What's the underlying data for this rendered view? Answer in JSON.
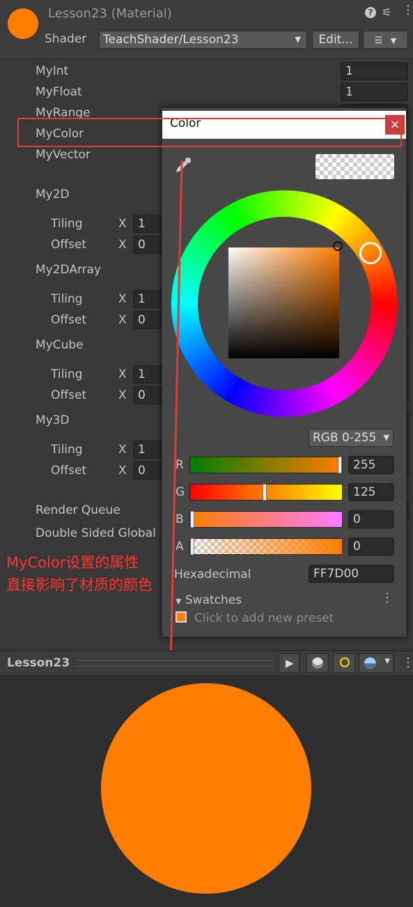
{
  "header": {
    "title": "Lesson23 (Material)",
    "shader_label": "Shader",
    "shader_value": "TeachShader/Lesson23",
    "edit_button": "Edit...",
    "material_color": "#ff7d00"
  },
  "properties": {
    "myint": {
      "label": "MyInt",
      "value": "1"
    },
    "myfloat": {
      "label": "MyFloat",
      "value": "1"
    },
    "myrange": {
      "label": "MyRange"
    },
    "mycolor": {
      "label": "MyColor"
    },
    "myvector": {
      "label": "MyVector"
    },
    "my2d": {
      "label": "My2D",
      "tiling_label": "Tiling",
      "offset_label": "Offset",
      "x": "X",
      "tiling_x": "1",
      "offset_x": "0"
    },
    "my2darray": {
      "label": "My2DArray",
      "tiling_label": "Tiling",
      "offset_label": "Offset",
      "x": "X",
      "tiling_x": "1",
      "offset_x": "0"
    },
    "mycube": {
      "label": "MyCube",
      "tiling_label": "Tiling",
      "offset_label": "Offset",
      "x": "X",
      "tiling_x": "1",
      "offset_x": "0"
    },
    "my3d": {
      "label": "My3D",
      "tiling_label": "Tiling",
      "offset_label": "Offset",
      "x": "X",
      "tiling_x": "1",
      "offset_x": "0"
    },
    "render_queue": "Render Queue",
    "double_sided": "Double Sided Global"
  },
  "annotation": {
    "line1": "MyColor设置的属性",
    "line2": "直接影响了材质的颜色",
    "color": "#ff3333"
  },
  "color_picker": {
    "title": "Color",
    "close": "×",
    "mode": "RGB 0-255",
    "channels": {
      "r": {
        "label": "R",
        "value": "255"
      },
      "g": {
        "label": "G",
        "value": "125"
      },
      "b": {
        "label": "B",
        "value": "0"
      },
      "a": {
        "label": "A",
        "value": "0"
      }
    },
    "hex_label": "Hexadecimal",
    "hex_value": "FF7D00",
    "swatches_label": "Swatches",
    "add_preset": "Click to add new preset"
  },
  "preview": {
    "title": "Lesson23",
    "sphere_color": "#ff7d00"
  }
}
